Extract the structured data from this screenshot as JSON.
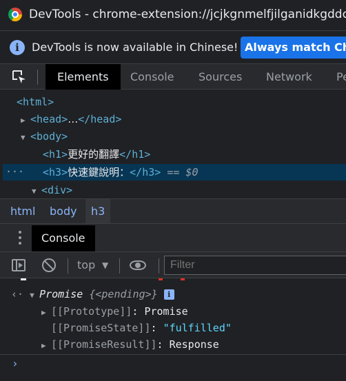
{
  "window": {
    "title": "DevTools - chrome-extension://jcjkgnmelfjilganidkgddc"
  },
  "infobar": {
    "message": "DevTools is now available in Chinese!",
    "button": "Always match Chro"
  },
  "tabs": [
    "Elements",
    "Console",
    "Sources",
    "Network",
    "Pe"
  ],
  "elements": {
    "html_open": "<html>",
    "head_open": "<head>",
    "head_ellipsis": "…",
    "head_close": "</head>",
    "body_open": "<body>",
    "h1_open": "<h1>",
    "h1_text": "更好的翻譯",
    "h1_close": "</h1>",
    "h3_open": "<h3>",
    "h3_text": "快速鍵說明：",
    "h3_close": "</h3>",
    "selected_suffix": " == ",
    "selected_var": "$0",
    "div_open": "<div>"
  },
  "breadcrumbs": [
    "html",
    "body",
    "h3"
  ],
  "drawer": {
    "tab": "Console"
  },
  "console_toolbar": {
    "context": "top",
    "filter_placeholder": "Filter"
  },
  "console": {
    "promise_label": "Promise",
    "promise_state_brief": "{<pending>}",
    "prototype_key": "[[Prototype]]",
    "prototype_value": "Promise",
    "state_key": "[[PromiseState]]",
    "state_value": "\"fulfilled\"",
    "result_key": "[[PromiseResult]]",
    "result_value": "Response"
  },
  "colors": {
    "tag": "#5db0d7",
    "selection": "#073655",
    "accent_button": "#1a73e8",
    "string": "#5cd5fb"
  }
}
